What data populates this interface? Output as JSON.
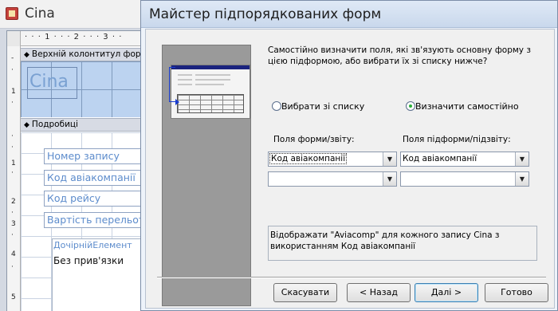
{
  "background_window": {
    "title": "Cina",
    "ruler_top": "· · · 1 · · · 2 · · · 3 · ·",
    "ruler_left": [
      "-",
      "·",
      "1",
      "·",
      "·",
      "·",
      "1",
      "·",
      "2",
      "·",
      "3",
      "·",
      "4",
      "·",
      "5"
    ],
    "section_header": "Верхній колонтитул форми",
    "header_label": "Cina",
    "section_detail": "Подробиці",
    "fields": [
      "Номер запису",
      "Код авіакомпанії",
      "Код рейсу",
      "Вартість перельоту"
    ],
    "subform_label": "ДочірнійЕлемент",
    "subform_unbound": "Без прив'язки"
  },
  "dialog": {
    "title": "Майстер підпорядкованих форм",
    "description": "Самостійно визначити поля, які зв'язують основну форму з цією підформою, або вибрати їх зі списку нижче?",
    "radio_choose": "Вибрати зі списку",
    "radio_define": "Визначити самостійно",
    "radio_selected": "define",
    "form_fields_label": "Поля форми/звіту:",
    "subform_fields_label": "Поля підформи/підзвіту:",
    "form_field_1": "Код авіакомпанії",
    "form_field_2": "",
    "subform_field_1": "Код авіакомпанії",
    "subform_field_2": "",
    "info_text": "Відображати \"Aviacomp\" для кожного запису Cina з використанням Код авіакомпанії",
    "buttons": {
      "cancel": "Скасувати",
      "back": "< Назад",
      "next": "Далі >",
      "finish": "Готово"
    }
  }
}
